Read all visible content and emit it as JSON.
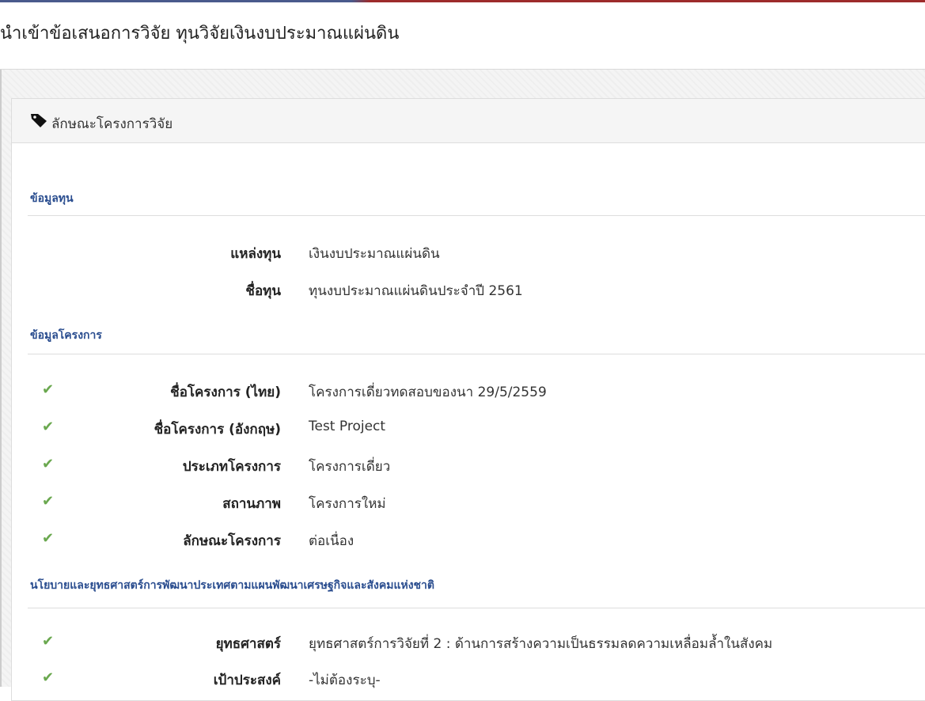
{
  "page": {
    "title": "นำเข้าข้อเสนอการวิจัย ทุนวิจัยเงินงบประมาณแผ่นดิน"
  },
  "panel": {
    "icon": "tag-icon",
    "title": "ลักษณะโครงการวิจัย"
  },
  "sections": {
    "funding": {
      "title": "ข้อมูลทุน",
      "rows": [
        {
          "label": "แหล่งทุน",
          "value": "เงินงบประมาณแผ่นดิน"
        },
        {
          "label": "ชื่อทุน",
          "value": "ทุนงบประมาณแผ่นดินประจำปี 2561"
        }
      ]
    },
    "project": {
      "title": "ข้อมูลโครงการ",
      "rows": [
        {
          "label": "ชื่อโครงการ (ไทย)",
          "value": "โครงการเดี่ยวทดสอบของนา 29/5/2559",
          "checked": true
        },
        {
          "label": "ชื่อโครงการ (อังกฤษ)",
          "value": "Test Project",
          "checked": true
        },
        {
          "label": "ประเภทโครงการ",
          "value": "โครงการเดี่ยว",
          "checked": true
        },
        {
          "label": "สถานภาพ",
          "value": "โครงการใหม่",
          "checked": true
        },
        {
          "label": "ลักษณะโครงการ",
          "value": "ต่อเนื่อง",
          "checked": true
        }
      ]
    },
    "policy": {
      "title": "นโยบายและยุทธศาสตร์การพัฒนาประเทศตามแผนพัฒนาเศรษฐกิจและสังคมแห่งชาติ",
      "rows": [
        {
          "label": "ยุทธศาสตร์",
          "value": "ยุทธศาสตร์การวิจัยที่ 2 : ด้านการสร้างความเป็นธรรมลดความเหลื่อมล้ำในสังคม",
          "checked": true
        },
        {
          "label": "เป้าประสงค์",
          "value": "-ไม่ต้องระบุ-",
          "checked": true
        }
      ]
    }
  },
  "colors": {
    "accent": "#2a4d8f",
    "check": "#6aa84f"
  },
  "icons": {
    "check": "✔"
  }
}
